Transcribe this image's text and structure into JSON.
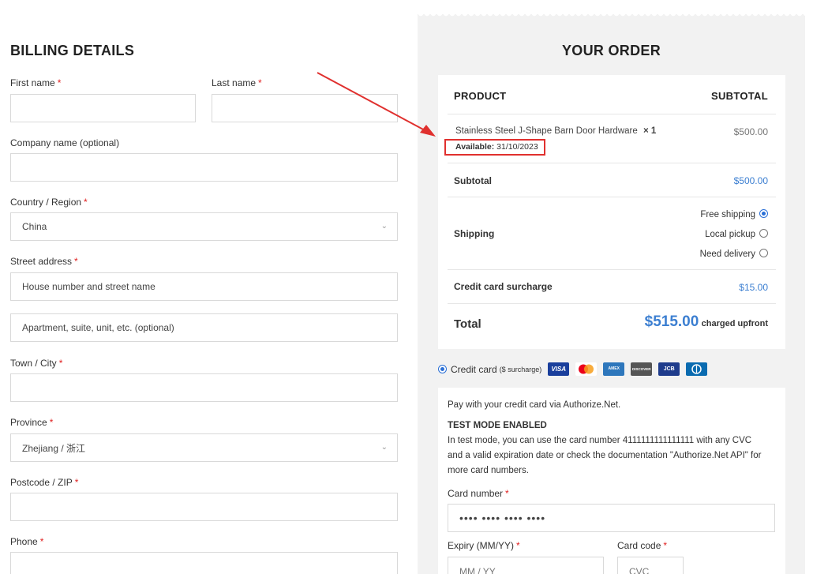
{
  "billing": {
    "title": "BILLING DETAILS",
    "first_name_label": "First name",
    "last_name_label": "Last name",
    "company_label": "Company name (optional)",
    "country_label": "Country / Region",
    "country_value": "China",
    "street_label": "Street address",
    "street_placeholder": "House number and street name",
    "apartment_placeholder": "Apartment, suite, unit, etc. (optional)",
    "city_label": "Town / City",
    "province_label": "Province",
    "province_value": "Zhejiang / 浙江",
    "postcode_label": "Postcode / ZIP",
    "phone_label": "Phone",
    "required_mark": "*"
  },
  "order": {
    "title": "YOUR ORDER",
    "col_product": "PRODUCT",
    "col_subtotal": "SUBTOTAL",
    "item_name": "Stainless Steel J-Shape Barn Door Hardware",
    "item_qty": "× 1",
    "item_price": "$500.00",
    "available_label": "Available:",
    "available_date": "31/10/2023",
    "subtotal_label": "Subtotal",
    "subtotal_value": "$500.00",
    "shipping_label": "Shipping",
    "shipping_options": [
      {
        "label": "Free shipping",
        "selected": true
      },
      {
        "label": "Local pickup",
        "selected": false
      },
      {
        "label": "Need delivery",
        "selected": false
      }
    ],
    "surcharge_label": "Credit card surcharge",
    "surcharge_value": "$15.00",
    "total_label": "Total",
    "total_value": "$515.00",
    "total_note": "charged upfront"
  },
  "payment": {
    "method_label": "Credit card",
    "method_note": "($ surcharge)",
    "logos": [
      "VISA",
      "MC",
      "AMEX",
      "DISCOVER",
      "JCB",
      "DINERS"
    ],
    "desc": "Pay with your credit card via Authorize.Net.",
    "test_title": "TEST MODE ENABLED",
    "test_text_1": "In test mode, you can use the card number 4111111111111111 with any CVC",
    "test_text_2": "and a valid expiration date or check the documentation \"Authorize.Net API\" for",
    "test_text_3": "more card numbers.",
    "card_number_label": "Card number",
    "card_number_placeholder": "•••• •••• •••• ••••",
    "expiry_label": "Expiry (MM/YY)",
    "expiry_placeholder": "MM / YY",
    "cvc_label": "Card code",
    "cvc_placeholder": "CVC"
  },
  "colors": {
    "accent": "#3c7fd1",
    "required": "#e02020",
    "annotation": "#e0302e",
    "panel_bg": "#f2f2f2"
  }
}
